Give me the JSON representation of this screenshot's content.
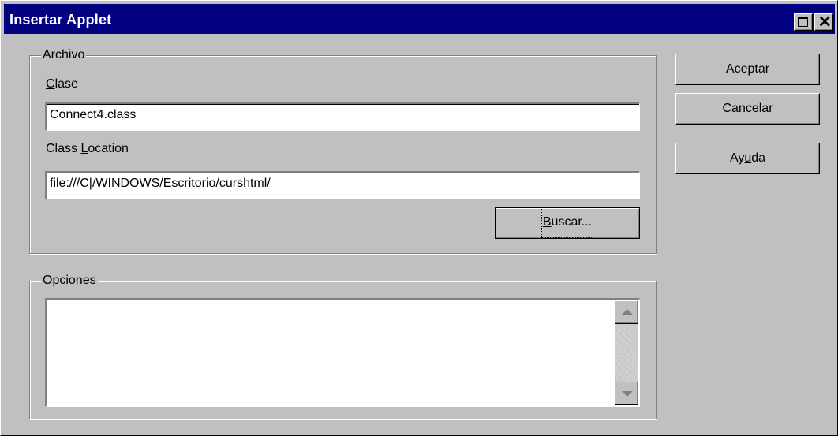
{
  "window": {
    "title": "Insertar Applet",
    "title_bar_color": "#000080",
    "buttons": {
      "maximize_icon": "maximize-icon",
      "close_icon": "close-icon"
    }
  },
  "archivo_group": {
    "legend": "Archivo",
    "clase_label": {
      "underline": "C",
      "rest": "lase"
    },
    "clase_value": "Connect4.class",
    "location_label": {
      "before": "Class ",
      "underline": "L",
      "rest": "ocation"
    },
    "location_value": "file:///C|/WINDOWS/Escritorio/curshtml/",
    "buscar_button": {
      "underline": "B",
      "rest": "uscar..."
    }
  },
  "opciones_group": {
    "legend": "Opciones",
    "value": ""
  },
  "buttons": {
    "aceptar": "Aceptar",
    "cancelar": "Cancelar",
    "ayuda": {
      "before": "Ay",
      "underline": "u",
      "rest": "da"
    }
  }
}
